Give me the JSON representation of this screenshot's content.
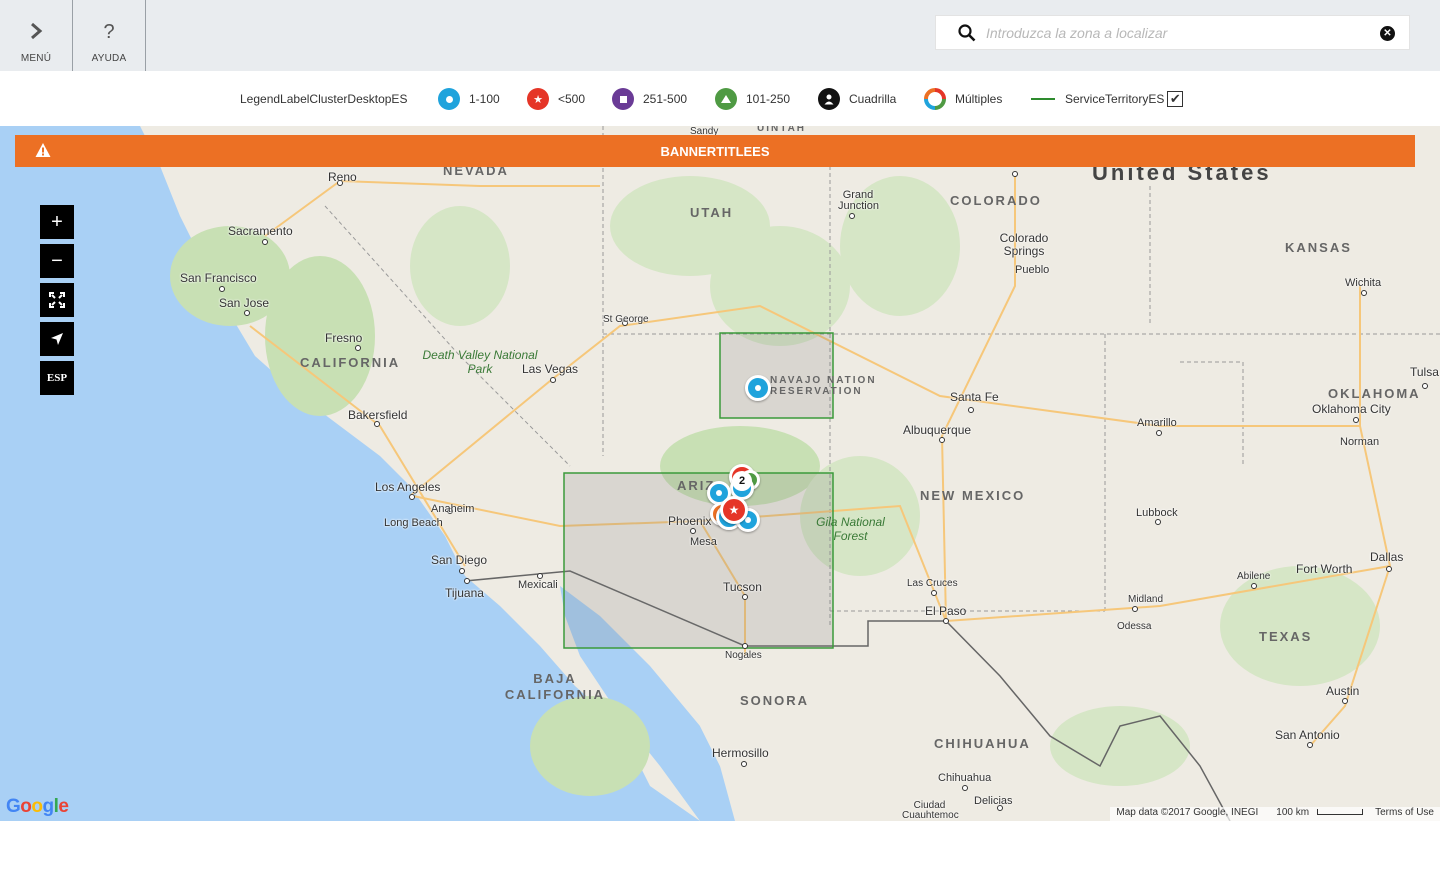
{
  "nav": {
    "menu_label": "MENÚ",
    "help_label": "AYUDA"
  },
  "search": {
    "placeholder": "Introduzca la zona a localizar",
    "value": ""
  },
  "legend": {
    "items": [
      {
        "label": "LegendLabelClusterDesktopES"
      },
      {
        "label": "1-100",
        "color": "#1fa3dc",
        "icon": "dot-icon"
      },
      {
        "label": "<500",
        "color": "#e53527",
        "icon": "star-icon"
      },
      {
        "label": "251-500",
        "color": "#6a3b96",
        "icon": "square-icon"
      },
      {
        "label": "101-250",
        "color": "#4f9a43",
        "icon": "triangle-icon"
      },
      {
        "label": "Cuadrilla",
        "color": "#111111",
        "icon": "person-icon"
      },
      {
        "label": "Múltiples",
        "color": "multi",
        "icon": "multi-ring-icon"
      },
      {
        "label": "ServiceTerritoryES",
        "color": "#2e8b2e",
        "icon": "line-icon",
        "checked": true
      }
    ]
  },
  "banner": {
    "title": "BANNERTITLEES",
    "color": "#ec7024"
  },
  "map_controls": {
    "zoom_in": "+",
    "zoom_out": "−",
    "locate_label": "ESP"
  },
  "map": {
    "country": "United States",
    "regions": [
      "NEVADA",
      "UTAH",
      "COLORADO",
      "KANSAS",
      "CALIFORNIA",
      "OKLAHOMA",
      "ARIZ",
      "NEW MEXICO",
      "TEXAS",
      "BAJA CALIFORNIA",
      "SONORA",
      "CHIHUAHUA",
      "NAVAJO NATION RESERVATION",
      "UINTAH"
    ],
    "parks": [
      "Death Valley National Park",
      "Gila National Forest"
    ],
    "cities": [
      "Reno",
      "Sacramento",
      "San Francisco",
      "San Jose",
      "Fresno",
      "Bakersfield",
      "Las Vegas",
      "St George",
      "Grand Junction",
      "Colorado Springs",
      "Pueblo",
      "Wichita",
      "Tulsa",
      "Oklahoma City",
      "Norman",
      "Santa Fe",
      "Albuquerque",
      "Amarillo",
      "Lubbock",
      "Los Angeles",
      "Anaheim",
      "Long Beach",
      "San Diego",
      "Tijuana",
      "Mexicali",
      "Phoenix",
      "Mesa",
      "Tucson",
      "Nogales",
      "Las Cruces",
      "El Paso",
      "Midland",
      "Odessa",
      "Abilene",
      "Fort Worth",
      "Dallas",
      "Austin",
      "San Antonio",
      "Hermosillo",
      "Chihuahua",
      "Delicias",
      "Ciudad Cuauhtemoc",
      "Sandy"
    ],
    "cluster_count": "2",
    "attribution": "Map data ©2017 Google, INEGI",
    "scale": "100 km",
    "terms": "Terms of Use",
    "google_logo": "Google"
  }
}
